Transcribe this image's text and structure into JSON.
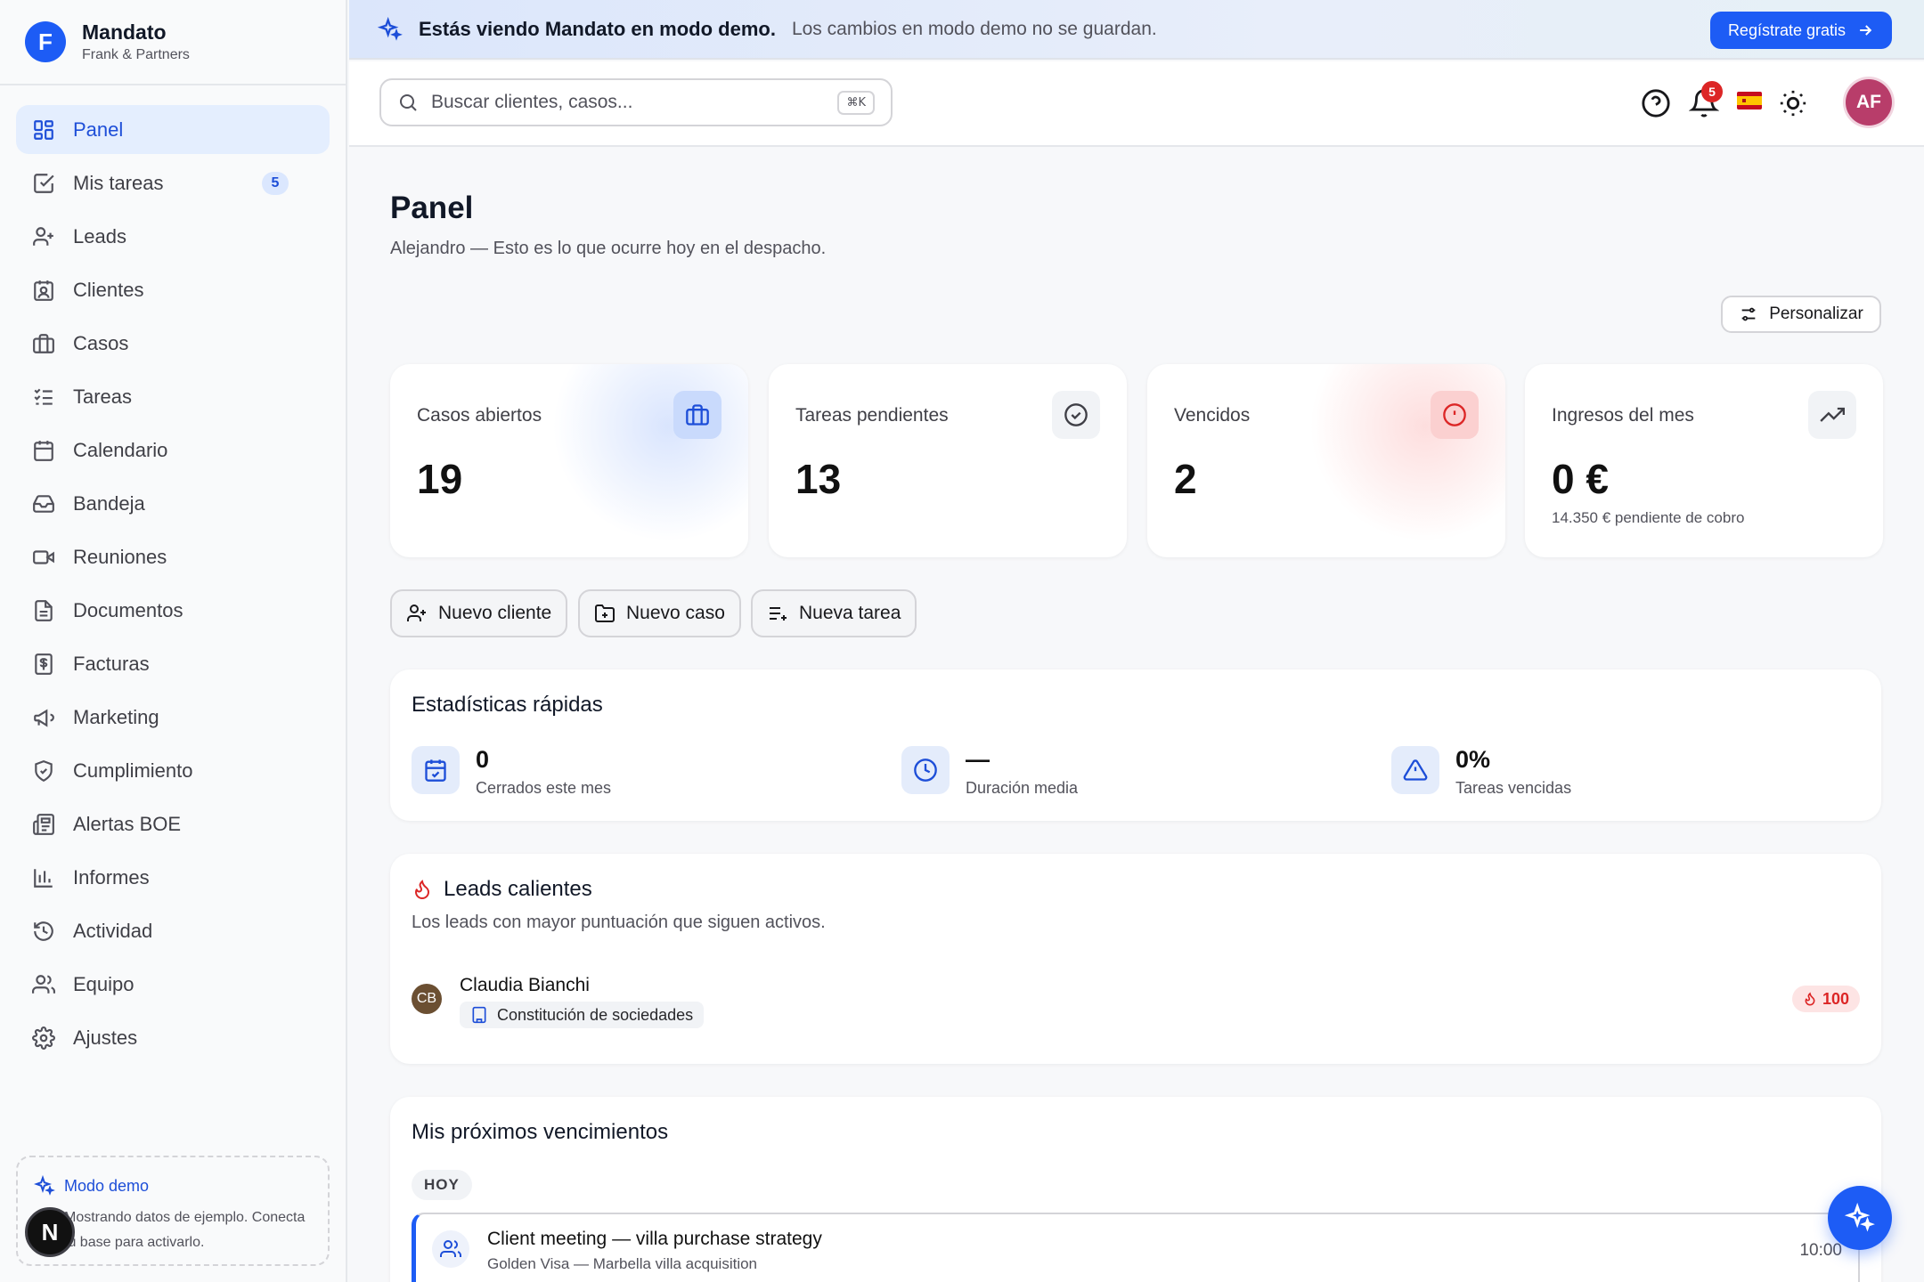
{
  "brand": {
    "initial": "F",
    "name": "Mandato",
    "subtitle": "Frank & Partners"
  },
  "sidebar": {
    "items": [
      {
        "label": "Panel",
        "icon": "grid-icon",
        "active": true
      },
      {
        "label": "Mis tareas",
        "icon": "check-square-icon",
        "badge": "5"
      },
      {
        "label": "Leads",
        "icon": "user-plus-icon"
      },
      {
        "label": "Clientes",
        "icon": "contact-icon"
      },
      {
        "label": "Casos",
        "icon": "briefcase-icon"
      },
      {
        "label": "Tareas",
        "icon": "list-check-icon"
      },
      {
        "label": "Calendario",
        "icon": "calendar-icon"
      },
      {
        "label": "Bandeja",
        "icon": "inbox-icon"
      },
      {
        "label": "Reuniones",
        "icon": "video-icon"
      },
      {
        "label": "Documentos",
        "icon": "file-icon"
      },
      {
        "label": "Facturas",
        "icon": "receipt-icon"
      },
      {
        "label": "Marketing",
        "icon": "megaphone-icon"
      },
      {
        "label": "Cumplimiento",
        "icon": "shield-check-icon"
      },
      {
        "label": "Alertas BOE",
        "icon": "newspaper-icon"
      },
      {
        "label": "Informes",
        "icon": "bar-chart-icon"
      },
      {
        "label": "Actividad",
        "icon": "history-icon"
      },
      {
        "label": "Equipo",
        "icon": "users-icon"
      },
      {
        "label": "Ajustes",
        "icon": "gear-icon"
      }
    ],
    "demo": {
      "title": "Modo demo",
      "line1": "Mostrando datos de ejemplo. Conecta",
      "line2": "tu base para activarlo."
    },
    "n_badge": "N"
  },
  "banner": {
    "strong": "Estás viendo Mandato en modo demo.",
    "soft": "Los cambios en modo demo no se guardan.",
    "cta": "Regístrate gratis"
  },
  "topbar": {
    "search_placeholder": "Buscar clientes, casos...",
    "shortcut": "⌘K",
    "notifications": "5",
    "flag": "ES",
    "avatar": "AF"
  },
  "main": {
    "title": "Panel",
    "subtitle": "Alejandro — Esto es lo que ocurre hoy en el despacho.",
    "customize": "Personalizar",
    "stats": [
      {
        "label": "Casos abiertos",
        "value": "19"
      },
      {
        "label": "Tareas pendientes",
        "value": "13"
      },
      {
        "label": "Vencidos",
        "value": "2"
      },
      {
        "label": "Ingresos del mes",
        "value": "0 €",
        "note": "14.350 € pendiente de cobro"
      }
    ],
    "quick_actions": [
      "Nuevo cliente",
      "Nuevo caso",
      "Nueva tarea"
    ],
    "quick_stats": {
      "title": "Estadísticas rápidas",
      "items": [
        {
          "value": "0",
          "label": "Cerrados este mes"
        },
        {
          "value": "—",
          "label": "Duración media"
        },
        {
          "value": "0%",
          "label": "Tareas vencidas"
        }
      ]
    },
    "hot_leads": {
      "title": "Leads calientes",
      "subtitle": "Los leads con mayor puntuación que siguen activos.",
      "lead": {
        "initials": "CB",
        "name": "Claudia Bianchi",
        "tag": "Constitución de sociedades",
        "score": "100"
      }
    },
    "deadlines": {
      "title": "Mis próximos vencimientos",
      "day": "HOY",
      "event": {
        "title": "Client meeting — villa purchase strategy",
        "subtitle": "Golden Visa — Marbella villa acquisition",
        "time": "10:00"
      }
    }
  },
  "colors": {
    "accent": "#1d5cf5",
    "danger": "#dc2626",
    "avatar": "#b83d6a"
  }
}
